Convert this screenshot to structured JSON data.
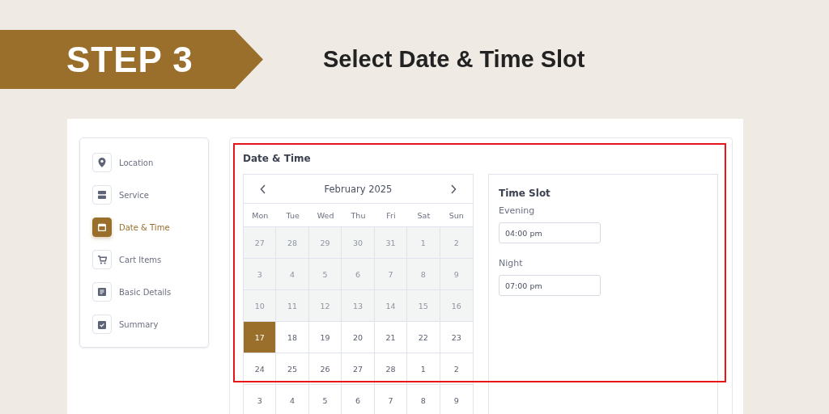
{
  "banner": {
    "step": "STEP 3",
    "title": "Select Date & Time Slot"
  },
  "steps": [
    {
      "label": "Location",
      "selected": false
    },
    {
      "label": "Service",
      "selected": false
    },
    {
      "label": "Date & Time",
      "selected": true
    },
    {
      "label": "Cart Items",
      "selected": false
    },
    {
      "label": "Basic Details",
      "selected": false
    },
    {
      "label": "Summary",
      "selected": false
    }
  ],
  "section_title": "Date & Time",
  "calendar": {
    "month": "February 2025",
    "weekdays": [
      "Mon",
      "Tue",
      "Wed",
      "Thu",
      "Fri",
      "Sat",
      "Sun"
    ],
    "weeks": [
      [
        {
          "day": "27",
          "disabled": true,
          "selected": false
        },
        {
          "day": "28",
          "disabled": true,
          "selected": false
        },
        {
          "day": "29",
          "disabled": true,
          "selected": false
        },
        {
          "day": "30",
          "disabled": true,
          "selected": false
        },
        {
          "day": "31",
          "disabled": true,
          "selected": false
        },
        {
          "day": "1",
          "disabled": true,
          "selected": false
        },
        {
          "day": "2",
          "disabled": true,
          "selected": false
        }
      ],
      [
        {
          "day": "3",
          "disabled": true,
          "selected": false
        },
        {
          "day": "4",
          "disabled": true,
          "selected": false
        },
        {
          "day": "5",
          "disabled": true,
          "selected": false
        },
        {
          "day": "6",
          "disabled": true,
          "selected": false
        },
        {
          "day": "7",
          "disabled": true,
          "selected": false
        },
        {
          "day": "8",
          "disabled": true,
          "selected": false
        },
        {
          "day": "9",
          "disabled": true,
          "selected": false
        }
      ],
      [
        {
          "day": "10",
          "disabled": true,
          "selected": false
        },
        {
          "day": "11",
          "disabled": true,
          "selected": false
        },
        {
          "day": "12",
          "disabled": true,
          "selected": false
        },
        {
          "day": "13",
          "disabled": true,
          "selected": false
        },
        {
          "day": "14",
          "disabled": true,
          "selected": false
        },
        {
          "day": "15",
          "disabled": true,
          "selected": false
        },
        {
          "day": "16",
          "disabled": true,
          "selected": false
        }
      ],
      [
        {
          "day": "17",
          "disabled": false,
          "selected": true
        },
        {
          "day": "18",
          "disabled": false,
          "selected": false
        },
        {
          "day": "19",
          "disabled": false,
          "selected": false
        },
        {
          "day": "20",
          "disabled": false,
          "selected": false
        },
        {
          "day": "21",
          "disabled": false,
          "selected": false
        },
        {
          "day": "22",
          "disabled": false,
          "selected": false
        },
        {
          "day": "23",
          "disabled": false,
          "selected": false
        }
      ],
      [
        {
          "day": "24",
          "disabled": false,
          "selected": false
        },
        {
          "day": "25",
          "disabled": false,
          "selected": false
        },
        {
          "day": "26",
          "disabled": false,
          "selected": false
        },
        {
          "day": "27",
          "disabled": false,
          "selected": false
        },
        {
          "day": "28",
          "disabled": false,
          "selected": false
        },
        {
          "day": "1",
          "disabled": false,
          "selected": false
        },
        {
          "day": "2",
          "disabled": false,
          "selected": false
        }
      ],
      [
        {
          "day": "3",
          "disabled": false,
          "selected": false
        },
        {
          "day": "4",
          "disabled": false,
          "selected": false
        },
        {
          "day": "5",
          "disabled": false,
          "selected": false
        },
        {
          "day": "6",
          "disabled": false,
          "selected": false
        },
        {
          "day": "7",
          "disabled": false,
          "selected": false
        },
        {
          "day": "8",
          "disabled": false,
          "selected": false
        },
        {
          "day": "9",
          "disabled": false,
          "selected": false
        }
      ]
    ]
  },
  "time_slot": {
    "title": "Time Slot",
    "groups": [
      {
        "label": "Evening",
        "value": "04:00 pm"
      },
      {
        "label": "Night",
        "value": "07:00 pm"
      }
    ]
  }
}
